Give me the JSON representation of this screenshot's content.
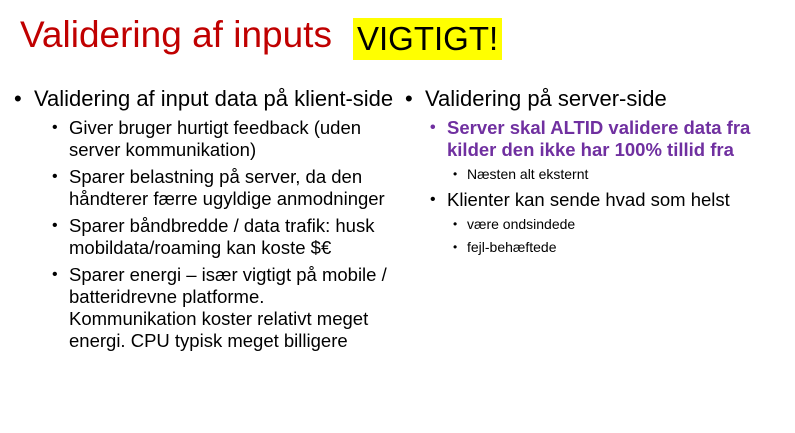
{
  "title": "Validering af inputs",
  "highlight": "VIGTIGT!",
  "left": {
    "heading": "Validering af input data på klient-side",
    "items": [
      "Giver bruger hurtigt feedback (uden server kommunikation)",
      "Sparer belastning på server, da den håndterer færre ugyldige anmodninger",
      "Sparer båndbredde / data trafik: husk mobildata/roaming kan koste $€",
      "Sparer energi – især vigtigt på mobile / batteridrevne platforme. Kommunikation koster relativt meget energi. CPU typisk meget billigere"
    ]
  },
  "right": {
    "heading": "Validering på server-side",
    "emphasis": "Server skal ALTID validere data fra kilder den ikke har 100% tillid fra",
    "emphasis_sub": "Næsten alt eksternt",
    "clients": "Klienter kan sende hvad som helst",
    "clients_sub": [
      "være ondsindede",
      "fejl-behæftede"
    ]
  },
  "colors": {
    "title": "#c00000",
    "highlight_bg": "#ffff00",
    "emphasis": "#7030a0"
  }
}
